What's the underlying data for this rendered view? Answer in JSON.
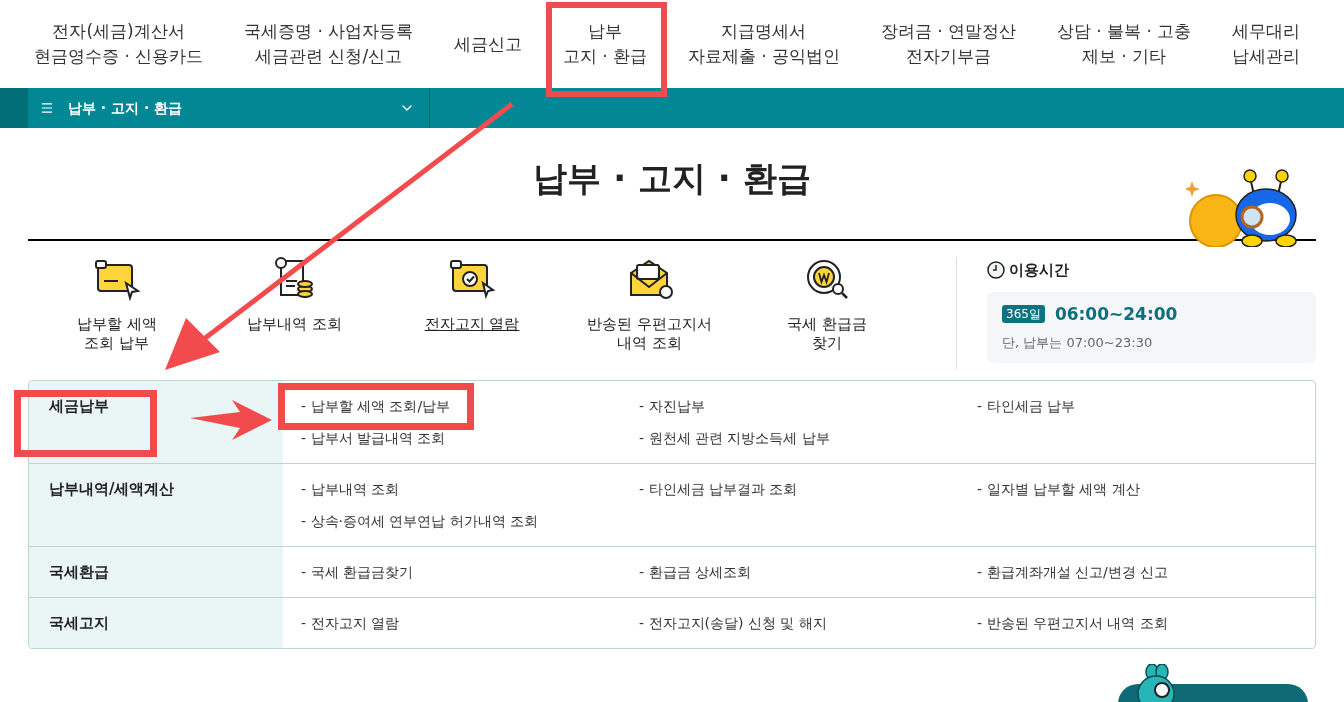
{
  "nav": {
    "items": [
      {
        "lines": [
          "전자(세금)계산서",
          "현금영수증 · 신용카드"
        ]
      },
      {
        "lines": [
          "국세증명 · 사업자등록",
          "세금관련 신청/신고"
        ]
      },
      {
        "lines": [
          "세금신고"
        ]
      },
      {
        "lines": [
          "납부",
          "고지 · 환급"
        ]
      },
      {
        "lines": [
          "지급명세서",
          "자료제출 · 공익법인"
        ]
      },
      {
        "lines": [
          "장려금 · 연말정산",
          "전자기부금"
        ]
      },
      {
        "lines": [
          "상담 · 불복 · 고충",
          "제보 · 기타"
        ]
      },
      {
        "lines": [
          "세무대리",
          "납세관리"
        ]
      }
    ]
  },
  "breadcrumb": {
    "label": "납부 · 고지 · 환급"
  },
  "page_title": "납부 · 고지 · 환급",
  "quick_links": [
    {
      "kind": "card",
      "lines": [
        "납부할 세액",
        "조회 납부"
      ],
      "underlined": false
    },
    {
      "kind": "receipt",
      "lines": [
        "납부내역 조회"
      ],
      "underlined": false
    },
    {
      "kind": "card_check",
      "lines": [
        "전자고지 열람"
      ],
      "underlined": true
    },
    {
      "kind": "envelope",
      "lines": [
        "반송된 우편고지서",
        "내역 조회"
      ],
      "underlined": false
    },
    {
      "kind": "coin_search",
      "lines": [
        "국세 환급금",
        "찾기"
      ],
      "underlined": false
    }
  ],
  "hours": {
    "title": "이용시간",
    "badge": "365일",
    "time": "06:00~24:00",
    "note": "단, 납부는 07:00~23:30"
  },
  "menu_table": {
    "rows": [
      {
        "category": "세금납부",
        "links": [
          "- 납부할 세액 조회/납부",
          "- 자진납부",
          "- 타인세금 납부",
          "- 납부서 발급내역 조회",
          "- 원천세 관련 지방소득세 납부"
        ]
      },
      {
        "category": "납부내역/세액계산",
        "links": [
          "- 납부내역 조회",
          "- 타인세금 납부결과 조회",
          "- 일자별 납부할 세액 계산",
          "- 상속·증여세 연부연납 허가내역 조회"
        ]
      },
      {
        "category": "국세환급",
        "links": [
          "- 국세 환급금찾기",
          "- 환급금 상세조회",
          "- 환급계좌개설 신고/변경 신고"
        ]
      },
      {
        "category": "국세고지",
        "links": [
          "- 전자고지 열람",
          "- 전자고지(송달) 신청 및 해지",
          "- 반송된 우편고지서 내역 조회"
        ]
      }
    ]
  }
}
